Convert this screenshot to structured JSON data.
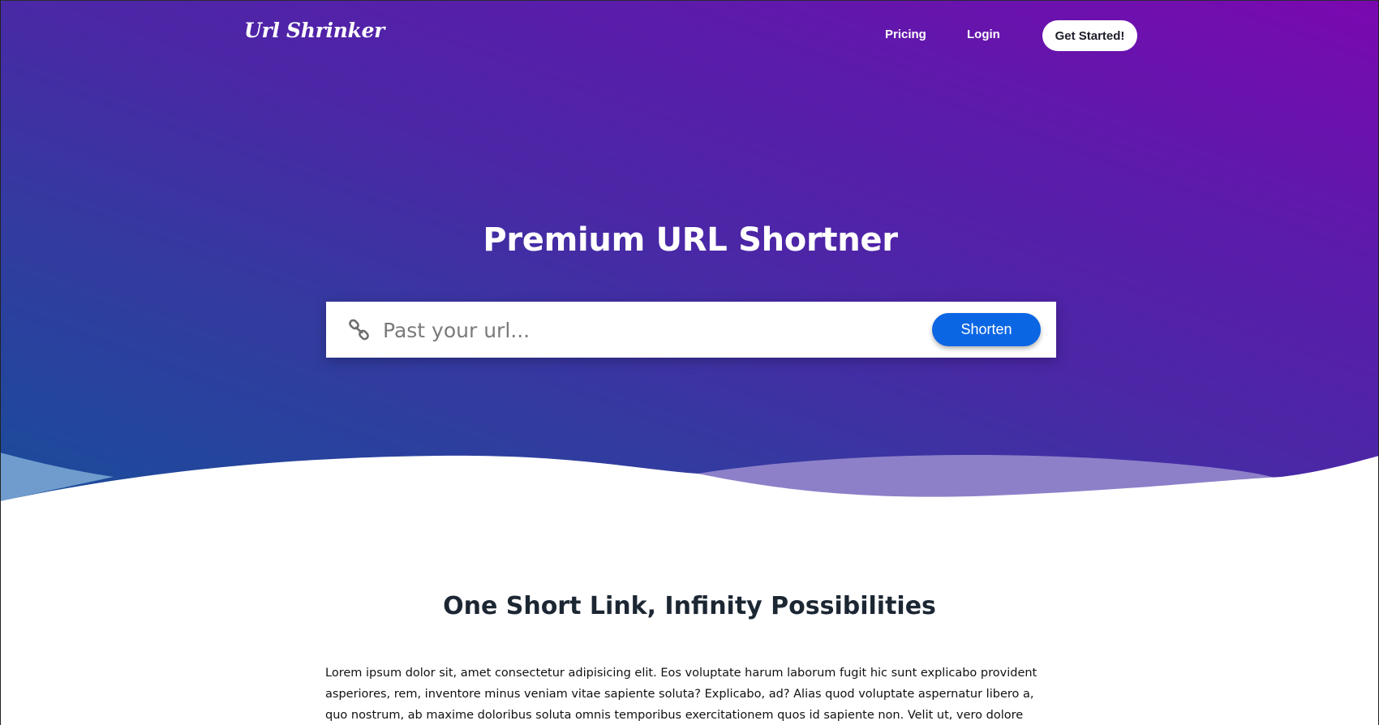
{
  "brand": {
    "logo_text": "Url Shrinker"
  },
  "nav": {
    "links": [
      {
        "label": "Pricing"
      },
      {
        "label": "Login"
      }
    ],
    "cta_label": "Get Started!"
  },
  "hero": {
    "title": "Premium URL Shortner",
    "search": {
      "placeholder": "Past your url...",
      "value": "",
      "icon": "link-icon",
      "button_label": "Shorten"
    }
  },
  "section": {
    "title": "One Short Link, Infinity Possibilities",
    "body": "Lorem ipsum dolor sit, amet consectetur adipisicing elit. Eos voluptate harum laborum fugit hic sunt explicabo provident asperiores, rem, inventore minus veniam vitae sapiente soluta? Explicabo, ad? Alias quod voluptate aspernatur libero a, quo nostrum, ab maxime doloribus soluta omnis temporibus exercitationem quos id sapiente non. Velit ut, vero dolore officiis labore voluptate ipsam"
  },
  "colors": {
    "gradient_top_right": "#7a08b0",
    "gradient_bottom_left": "#1a4c9a",
    "primary_button": "#0b66e4",
    "heading_dark": "#1c2733"
  }
}
